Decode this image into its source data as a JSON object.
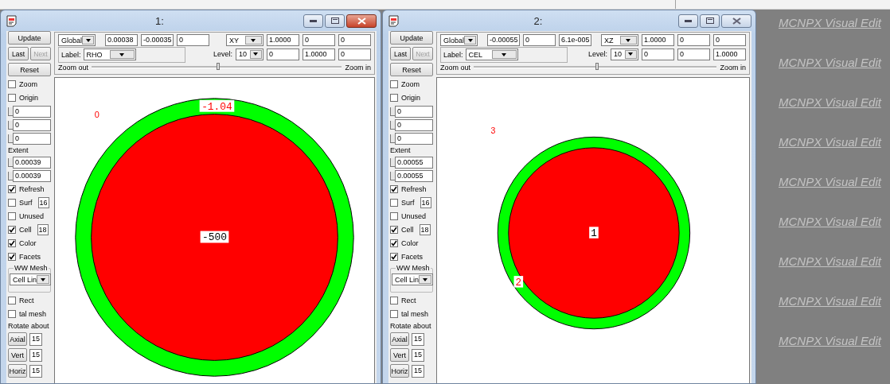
{
  "windows": [
    {
      "title": "1:",
      "active": true,
      "toolbar": {
        "coord_system": "Global",
        "origin": [
          "0.00038",
          "-0.00035",
          "0"
        ],
        "plane": "XY",
        "basis_u": [
          "1.0000",
          "0",
          "0"
        ],
        "basis_v": [
          "0",
          "1.0000",
          "0"
        ],
        "label_caption": "Label:",
        "label_value": "RHO",
        "level_caption": "Level:",
        "level_value": "10",
        "zoom_out": "Zoom out",
        "zoom_in": "Zoom in",
        "zoom": {
          "level": 0.5
        }
      },
      "sidebar": [
        {
          "kind": "button",
          "label": "Update"
        },
        {
          "kind": "pair",
          "buttons": [
            {
              "label": "Last",
              "disabled": false
            },
            {
              "label": "Next",
              "disabled": true
            }
          ]
        },
        {
          "kind": "button",
          "label": "Reset"
        },
        {
          "kind": "check",
          "label": "Zoom",
          "checked": false
        },
        {
          "kind": "check",
          "label": "Origin",
          "checked": false
        },
        {
          "kind": "slider",
          "value": "0"
        },
        {
          "kind": "slider",
          "value": "0"
        },
        {
          "kind": "slider",
          "value": "0"
        },
        {
          "kind": "caption",
          "label": "Extent"
        },
        {
          "kind": "slider",
          "value": "0.00039"
        },
        {
          "kind": "slider",
          "value": "0.00039"
        },
        {
          "kind": "check",
          "label": "Refresh",
          "checked": true
        },
        {
          "kind": "check",
          "label": "Surf",
          "checked": false,
          "value": "16"
        },
        {
          "kind": "check",
          "label": "Unused",
          "checked": false
        },
        {
          "kind": "check",
          "label": "Cell",
          "checked": true,
          "value": "18"
        },
        {
          "kind": "check",
          "label": "Color",
          "checked": true
        },
        {
          "kind": "check",
          "label": "Facets",
          "checked": true
        },
        {
          "kind": "group",
          "label": "WW Mesh",
          "value": "Cell Lin"
        },
        {
          "kind": "check",
          "label": "Rect",
          "checked": false
        },
        {
          "kind": "check",
          "label": "tal mesh",
          "checked": false
        },
        {
          "kind": "caption",
          "label": "Rotate about"
        },
        {
          "kind": "rotate",
          "label": "Axial",
          "value": "15"
        },
        {
          "kind": "rotate",
          "label": "Vert",
          "value": "15"
        },
        {
          "kind": "rotate",
          "label": "Horiz",
          "value": "15"
        }
      ],
      "plot": {
        "outside_label": "0",
        "regions": [
          {
            "label": "-1.04",
            "color": "#00ff00"
          },
          {
            "label": "-500",
            "color": "#ff0000"
          }
        ]
      }
    },
    {
      "title": "2:",
      "active": false,
      "toolbar": {
        "coord_system": "Global",
        "origin": [
          "-0.00055",
          "0",
          "6.1e-005"
        ],
        "plane": "XZ",
        "basis_u": [
          "1.0000",
          "0",
          "0"
        ],
        "basis_v": [
          "0",
          "0",
          "1.0000"
        ],
        "label_caption": "Label:",
        "label_value": "CEL",
        "level_caption": "Level:",
        "level_value": "10",
        "zoom_out": "Zoom out",
        "zoom_in": "Zoom in",
        "zoom": {
          "level": 0.5
        }
      },
      "sidebar": [
        {
          "kind": "button",
          "label": "Update"
        },
        {
          "kind": "pair",
          "buttons": [
            {
              "label": "Last",
              "disabled": false
            },
            {
              "label": "Next",
              "disabled": true
            }
          ]
        },
        {
          "kind": "button",
          "label": "Reset"
        },
        {
          "kind": "check",
          "label": "Zoom",
          "checked": false
        },
        {
          "kind": "check",
          "label": "Origin",
          "checked": false
        },
        {
          "kind": "slider",
          "value": "0"
        },
        {
          "kind": "slider",
          "value": "0"
        },
        {
          "kind": "slider",
          "value": "0"
        },
        {
          "kind": "caption",
          "label": "Extent"
        },
        {
          "kind": "slider",
          "value": "0.00055"
        },
        {
          "kind": "slider",
          "value": "0.00055"
        },
        {
          "kind": "check",
          "label": "Refresh",
          "checked": true
        },
        {
          "kind": "check",
          "label": "Surf",
          "checked": false,
          "value": "16"
        },
        {
          "kind": "check",
          "label": "Unused",
          "checked": false
        },
        {
          "kind": "check",
          "label": "Cell",
          "checked": true,
          "value": "18"
        },
        {
          "kind": "check",
          "label": "Color",
          "checked": true
        },
        {
          "kind": "check",
          "label": "Facets",
          "checked": true
        },
        {
          "kind": "group",
          "label": "WW Mesh",
          "value": "Cell Lin"
        },
        {
          "kind": "check",
          "label": "Rect",
          "checked": false
        },
        {
          "kind": "check",
          "label": "tal mesh",
          "checked": false
        },
        {
          "kind": "caption",
          "label": "Rotate about"
        },
        {
          "kind": "rotate",
          "label": "Axial",
          "value": "15"
        },
        {
          "kind": "rotate",
          "label": "Vert",
          "value": "15"
        },
        {
          "kind": "rotate",
          "label": "Horiz",
          "value": "15"
        }
      ],
      "plot": {
        "outside_label": "3",
        "regions": [
          {
            "label": "2",
            "color": "#00ff00"
          },
          {
            "label": "1",
            "color": "#ff0000"
          }
        ]
      }
    }
  ],
  "background_texts": [
    "MCNPX Visual Edit",
    "MCNPX Visual Edit",
    "MCNPX Visual Edit",
    "MCNPX Visual Edit",
    "MCNPX Visual Edit",
    "MCNPX Visual Edit",
    "MCNPX Visual Edit",
    "MCNPX Visual Edit",
    "MCNPX Visual Edit"
  ]
}
